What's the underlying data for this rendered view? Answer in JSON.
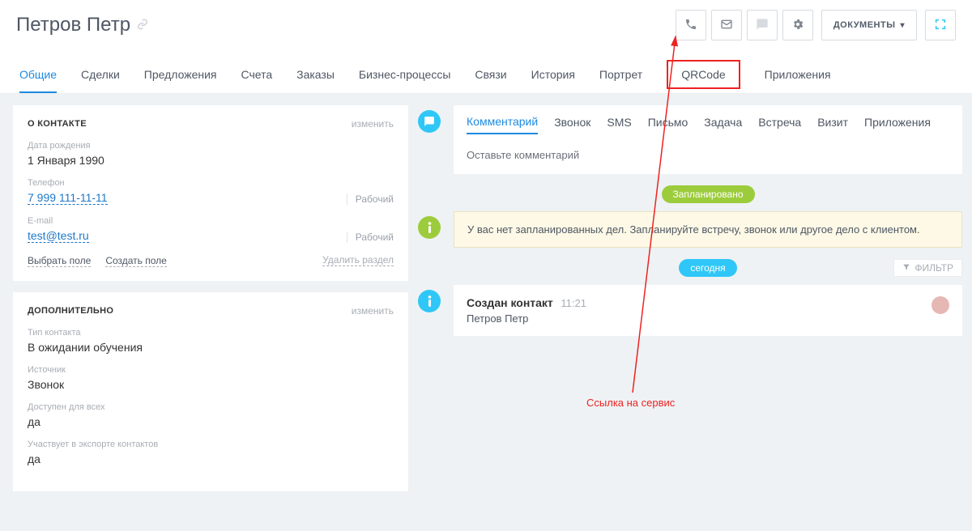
{
  "header": {
    "title": "Петров Петр",
    "docs_button": "ДОКУМЕНТЫ"
  },
  "tabs": [
    "Общие",
    "Сделки",
    "Предложения",
    "Счета",
    "Заказы",
    "Бизнес-процессы",
    "Связи",
    "История",
    "Портрет",
    "QRCode",
    "Приложения"
  ],
  "about": {
    "section_title": "О КОНТАКТЕ",
    "edit": "изменить",
    "birth_label": "Дата рождения",
    "birth_value": "1 Января 1990",
    "phone_label": "Телефон",
    "phone_value": "7 999 111-11-11",
    "phone_type": "Рабочий",
    "email_label": "E-mail",
    "email_value": "test@test.ru",
    "email_type": "Рабочий",
    "choose_field": "Выбрать поле",
    "create_field": "Создать поле",
    "delete_section": "Удалить раздел"
  },
  "extra": {
    "section_title": "ДОПОЛНИТЕЛЬНО",
    "edit": "изменить",
    "contact_type_label": "Тип контакта",
    "contact_type_value": "В ожидании обучения",
    "source_label": "Источник",
    "source_value": "Звонок",
    "public_label": "Доступен для всех",
    "public_value": "да",
    "export_label": "Участвует в экспорте контактов",
    "export_value": "да"
  },
  "compose": {
    "tabs": [
      "Комментарий",
      "Звонок",
      "SMS",
      "Письмо",
      "Задача",
      "Встреча",
      "Визит",
      "Приложения"
    ],
    "placeholder": "Оставьте комментарий"
  },
  "timeline": {
    "planned_chip": "Запланировано",
    "no_plans": "У вас нет запланированных дел. Запланируйте встречу, звонок или другое дело с клиентом.",
    "today_chip": "сегодня",
    "filter_label": "ФИЛЬТР",
    "event_title": "Создан контакт",
    "event_time": "11:21",
    "event_body": "Петров Петр"
  },
  "annotation": {
    "text": "Ссылка на сервис"
  }
}
